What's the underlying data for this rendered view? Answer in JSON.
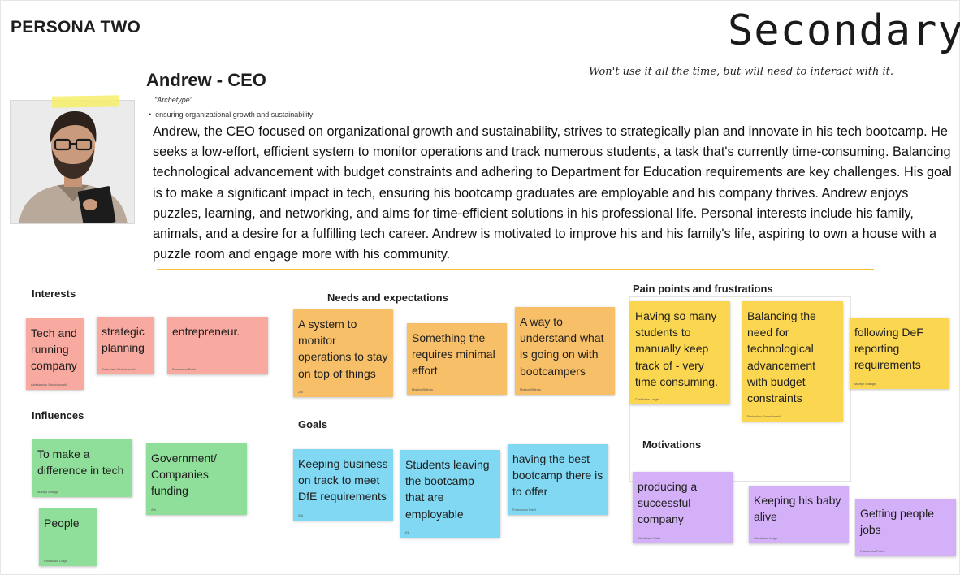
{
  "header": {
    "persona_label": "PERSONA TWO",
    "type_title": "Secondary",
    "type_subtitle": "Won't use it all the time, but will need to interact with it."
  },
  "profile": {
    "name": "Andrew - CEO",
    "archetype": "\"Archetype\"",
    "bullet": "ensuring organizational growth and sustainability",
    "bio": "Andrew, the CEO focused on organizational growth and sustainability, strives to strategically plan and innovate in his tech bootcamp. He seeks a low-effort, efficient system to monitor operations and track numerous students, a task that's currently time-consuming. Balancing technological advancement with budget constraints and adhering to Department for Education requirements are key challenges. His goal is to make a significant impact in tech, ensuring his bootcamp graduates are employable and his company thrives. Andrew enjoys puzzles, learning, and networking, and aims for time-efficient solutions in his professional life. Personal interests include his family, animals, and a desire for a fulfilling tech career. Andrew is motivated to improve his and his family's life, aspiring to own a house with a puzzle room and engage more with his community."
  },
  "sections": {
    "interests": "Interests",
    "influences": "Influences",
    "needs": "Needs and expectations",
    "goals": "Goals",
    "pain_points": "Pain points and frustrations",
    "motivations": "Motivations"
  },
  "notes": {
    "interests": [
      {
        "text": "Tech and running company",
        "author": "Aleksandar Swiechowski"
      },
      {
        "text": "strategic planning",
        "author": "Radoslaw Grzechowski"
      },
      {
        "text": "entrepreneur.",
        "author": "Francesca Palet"
      }
    ],
    "influences": [
      {
        "text": "To make a difference in tech",
        "author": "Martyn Billings"
      },
      {
        "text": "Government/ Companies funding",
        "author": "Zixi"
      },
      {
        "text": "People",
        "author": "Christiaan Leigh"
      }
    ],
    "needs": [
      {
        "text": "A system to monitor operations to stay on top of things",
        "author": "Zixi"
      },
      {
        "text": "Something the requires minimal effort",
        "author": "Martyn Billings"
      },
      {
        "text": "A way to understand what is going on with bootcampers",
        "author": "Martyn Billings"
      }
    ],
    "goals": [
      {
        "text": "Keeping business on track to meet DfE requirements",
        "author": "Zixi"
      },
      {
        "text": "Students leaving the bootcamp that are employable",
        "author": "Eli"
      },
      {
        "text": "having the best bootcamp there is to offer",
        "author": "Francesca Palet"
      }
    ],
    "pain_points": [
      {
        "text": "Having so many students to manually keep track of - very time consuming.",
        "author": "Christiaan Leigh"
      },
      {
        "text": "Balancing the need for technological advancement with budget constraints",
        "author": "Radoslaw Grzechowski"
      },
      {
        "text": "following DeF reporting requirements",
        "author": "Martyn Billings"
      }
    ],
    "motivations": [
      {
        "text": "producing a successful company",
        "author": "Christiaan Palet"
      },
      {
        "text": "Keeping his baby alive",
        "author": "Christiaan Leigh"
      },
      {
        "text": "Getting people jobs",
        "author": "Francesca Palet"
      }
    ]
  },
  "colors": {
    "pink": "#f8aaa0",
    "orange": "#f7bf67",
    "yellow": "#fbd650",
    "green": "#8fdf9a",
    "blue": "#80d8f2",
    "purple": "#d3b0f8",
    "divider": "#f5c33b"
  }
}
